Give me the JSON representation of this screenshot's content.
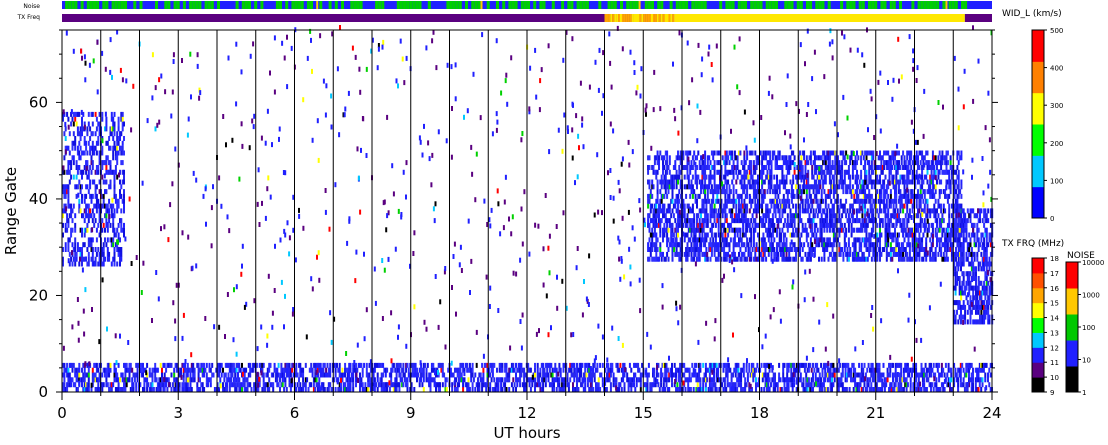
{
  "strip_labels": {
    "noise": "Noise",
    "txfreq": "TX Freq"
  },
  "chart_data": {
    "type": "heatmap",
    "xlabel": "UT hours",
    "ylabel": "Range Gate",
    "xlim": [
      0,
      24
    ],
    "ylim": [
      0,
      75
    ],
    "xticks": [
      "0",
      "3",
      "6",
      "9",
      "12",
      "15",
      "18",
      "21",
      "24"
    ],
    "yticks": [
      "0",
      "20",
      "40",
      "60"
    ],
    "hour_gridlines": true,
    "noise_strip": [
      {
        "from": 0,
        "to": 23.3,
        "level": "mixed-100-10"
      },
      {
        "from": 23.3,
        "to": 24,
        "level": "10"
      }
    ],
    "txfreq_strip": [
      {
        "from": 0,
        "to": 14,
        "mhz": 10
      },
      {
        "from": 14,
        "to": 15.8,
        "mhz": "13-14"
      },
      {
        "from": 15.8,
        "to": 23.3,
        "mhz": 13
      },
      {
        "from": 23.3,
        "to": 24,
        "mhz": 10
      }
    ],
    "colorbars": [
      {
        "title": "WID_L (km/s)",
        "ticks": [
          "500",
          "400",
          "300",
          "200",
          "100",
          "0"
        ],
        "colors": [
          "#0000ff",
          "#00c8ff",
          "#00ff00",
          "#ffff00",
          "#ff8000",
          "#ff0000"
        ]
      },
      {
        "title": "TX FRQ (MHz)",
        "ticks": [
          "18",
          "17",
          "16",
          "15",
          "14",
          "13",
          "12",
          "11",
          "10",
          "9"
        ],
        "colors": [
          "#000000",
          "#5a0080",
          "#2020ff",
          "#00c8ff",
          "#00ff00",
          "#ffff00",
          "#ffa500",
          "#ff5000",
          "#ff0000"
        ]
      },
      {
        "title": "NOISE",
        "ticks": [
          "10000",
          "1000",
          "100",
          "10",
          "1"
        ],
        "colors": [
          "#000000",
          "#2020ff",
          "#00c800",
          "#ffc800",
          "#ff0000"
        ]
      }
    ],
    "echo_regions": [
      {
        "name": "near-range ground scatter",
        "t": [
          0,
          24
        ],
        "gates": [
          0,
          6
        ],
        "density": "high",
        "color": "blue"
      },
      {
        "name": "dense scatter band",
        "t": [
          15.1,
          23.2
        ],
        "gates": [
          27,
          50
        ],
        "density": "high",
        "color": "blue"
      },
      {
        "name": "late-hour patch",
        "t": [
          23,
          24
        ],
        "gates": [
          14,
          38
        ],
        "density": "high",
        "color": "blue"
      },
      {
        "name": "early-hour patch",
        "t": [
          0,
          1.6
        ],
        "gates": [
          26,
          58
        ],
        "density": "medium",
        "color": "blue"
      }
    ]
  }
}
